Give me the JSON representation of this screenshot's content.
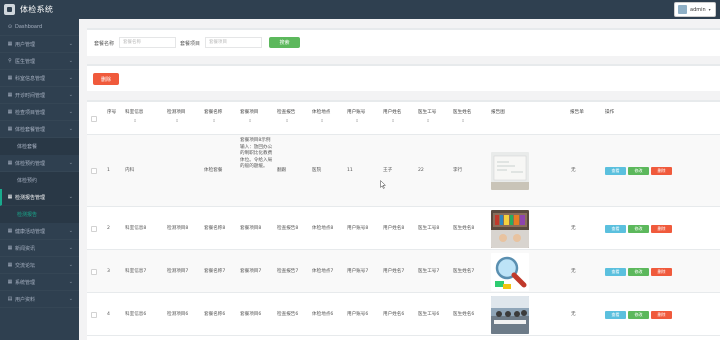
{
  "app": {
    "title": "体检系统",
    "user": "admin"
  },
  "sidebar": {
    "items": [
      {
        "id": "dashboard",
        "label": "Dashboard",
        "icon": "dashboard-icon",
        "glyph": "⊙"
      },
      {
        "id": "users",
        "label": "用户管理",
        "icon": "grid-icon",
        "glyph": "▦",
        "chevron": true
      },
      {
        "id": "doctors",
        "label": "医生管理",
        "icon": "pin-icon",
        "glyph": "⚲",
        "chevron": true
      },
      {
        "id": "dept",
        "label": "科室信息管理",
        "icon": "grid-icon",
        "glyph": "▦",
        "chevron": true
      },
      {
        "id": "opentime",
        "label": "开诊时间管理",
        "icon": "grid-icon",
        "glyph": "▦",
        "chevron": true
      },
      {
        "id": "items",
        "label": "检查项目管理",
        "icon": "grid-icon",
        "glyph": "▦",
        "chevron": true
      },
      {
        "id": "packages",
        "label": "体检套餐管理",
        "icon": "grid-icon",
        "glyph": "▦",
        "chevron": true
      },
      {
        "id": "packages-sub",
        "label": "体检套餐",
        "sub": true
      },
      {
        "id": "appointments",
        "label": "体检预约管理",
        "icon": "grid-icon",
        "glyph": "▦",
        "chevron": true
      },
      {
        "id": "appointments-sub",
        "label": "体检预约",
        "sub": true
      },
      {
        "id": "reports",
        "label": "检测报告管理",
        "icon": "grid-icon",
        "glyph": "▦",
        "chevron": true,
        "active": true
      },
      {
        "id": "reports-sub",
        "label": "检测报告",
        "sub": true,
        "active": true
      },
      {
        "id": "health",
        "label": "健康活动管理",
        "icon": "grid-icon",
        "glyph": "▦",
        "chevron": true
      },
      {
        "id": "news",
        "label": "新闻资讯",
        "icon": "grid-icon",
        "glyph": "▦",
        "chevron": true
      },
      {
        "id": "forum",
        "label": "交流论坛",
        "icon": "grid-icon",
        "glyph": "▦",
        "chevron": true
      },
      {
        "id": "system",
        "label": "系统管理",
        "icon": "grid-icon",
        "glyph": "▦",
        "chevron": true
      },
      {
        "id": "profile",
        "label": "用户资料",
        "icon": "doc-icon",
        "glyph": "▤",
        "chevron": true
      }
    ]
  },
  "search": {
    "label1": "套餐名称",
    "placeholder1": "套餐名称",
    "label2": "套餐项目",
    "placeholder2": "套餐项目",
    "button": "搜索"
  },
  "toolbar": {
    "delete": "删除"
  },
  "table": {
    "headers": [
      "序号",
      "科室信息",
      "检测项目",
      "套餐名称",
      "套餐项目",
      "检查报告",
      "体检地点",
      "用户账号",
      "用户姓名",
      "医生工号",
      "医生姓名",
      "报告图",
      "报告单",
      "操作"
    ],
    "sort_glyph": "⇕",
    "rows": [
      {
        "idx": "1",
        "dept": "内科",
        "item": "",
        "pkg": "体检套餐",
        "pkg_item": "套餐项目8示例输入：放回办公的制职比化教费体位。令给入局的般的题缓。",
        "report": "翻跟",
        "place": "医院",
        "account": "11",
        "uname": "王子",
        "doc_no": "22",
        "doc_name": "李行",
        "sheet": "无",
        "img": "whiteboard"
      },
      {
        "idx": "2",
        "dept": "科室信息8",
        "item": "检测项目8",
        "pkg": "套餐名称8",
        "pkg_item": "套餐项目8",
        "report": "检查报告8",
        "place": "体检地点8",
        "account": "用户账号8",
        "uname": "用户姓名8",
        "doc_no": "医生工号8",
        "doc_name": "医生姓名8",
        "sheet": "无",
        "img": "bookshelf"
      },
      {
        "idx": "3",
        "dept": "科室信息7",
        "item": "检测项目7",
        "pkg": "套餐名称7",
        "pkg_item": "套餐项目7",
        "report": "检查报告7",
        "place": "体检地点7",
        "account": "用户账号7",
        "uname": "用户姓名7",
        "doc_no": "医生工号7",
        "doc_name": "医生姓名7",
        "sheet": "无",
        "img": "magnifier"
      },
      {
        "idx": "4",
        "dept": "科室信息6",
        "item": "检测项目6",
        "pkg": "套餐名称6",
        "pkg_item": "套餐项目6",
        "report": "检查报告6",
        "place": "体检地点6",
        "account": "用户账号6",
        "uname": "用户姓名6",
        "doc_no": "医生工号6",
        "doc_name": "医生姓名6",
        "sheet": "无",
        "img": "classroom"
      }
    ],
    "ops": {
      "view": "查看",
      "edit": "修改",
      "del": "删除"
    }
  }
}
